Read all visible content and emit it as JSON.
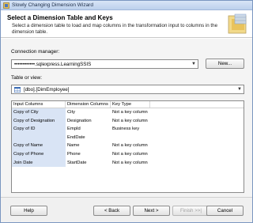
{
  "window": {
    "title": "Slowly Changing Dimension Wizard"
  },
  "header": {
    "title": "Select a Dimension Table and Keys",
    "description": "Select a dimension table to load and map columns in the transformation input to columns in the dimension table."
  },
  "connection": {
    "label": "Connection manager:",
    "value": "••••••••••••.sqlexpress.LearningSSIS",
    "new_button": "New..."
  },
  "table": {
    "label": "Table or view:",
    "value": "[dbo].[DimEmployee]"
  },
  "grid": {
    "columns": [
      "Input Columns",
      "Dimension Columns",
      "Key Type"
    ],
    "rows": [
      [
        "Copy of City",
        "City",
        "Not a key column"
      ],
      [
        "Copy of Designation",
        "Designation",
        "Not a key column"
      ],
      [
        "Copy of ID",
        "EmpId",
        "Business key"
      ],
      [
        "",
        "EndDate",
        ""
      ],
      [
        "Copy of Name",
        "Name",
        "Not a key column"
      ],
      [
        "Copy of Phone",
        "Phone",
        "Not a key column"
      ],
      [
        "Join Date",
        "StartDate",
        "Not a key column"
      ]
    ]
  },
  "footer": {
    "help": "Help",
    "back": "< Back",
    "next": "Next >",
    "finish": "Finish >>|",
    "cancel": "Cancel"
  }
}
